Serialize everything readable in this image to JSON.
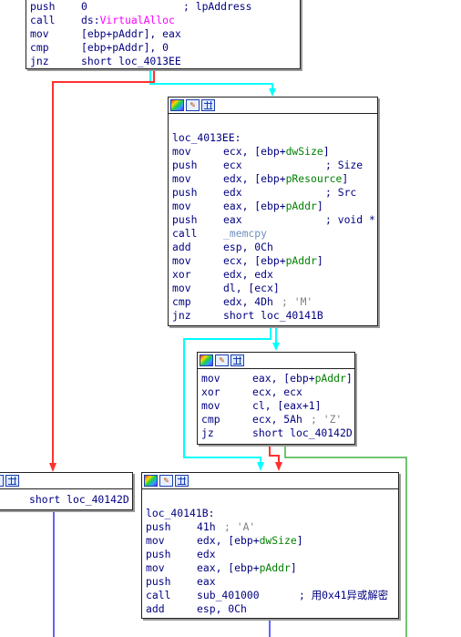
{
  "colors": {
    "edge_true": "#00ffff",
    "edge_false": "#ff3030",
    "edge_uncond": "#3030ff",
    "edge_green": "#40b040",
    "text": "#000080",
    "argument": "#008000",
    "import": "#ff00ff",
    "function": "#7090c0",
    "comment": "#808080"
  },
  "toolbar_icons": [
    "color-palette-icon",
    "edit-pencil-icon",
    "graph-view-icon"
  ],
  "block_top": {
    "lines": [
      {
        "mn": "push",
        "op": "0",
        "cm": "; lpAddress"
      },
      {
        "mn": "call",
        "op_pre": "ds:",
        "op_imp": "VirtualAlloc"
      },
      {
        "mn": "mov",
        "op": "[ebp+pAddr], eax"
      },
      {
        "mn": "cmp",
        "op": "[ebp+pAddr], 0"
      },
      {
        "mn": "jnz",
        "op": "short loc_4013EE"
      }
    ]
  },
  "block_4013ee": {
    "label": "loc_4013EE:",
    "lines": [
      {
        "mn": "mov",
        "op": "ecx, [ebp+",
        "arg": "dwSize",
        "post": "]"
      },
      {
        "mn": "push",
        "op": "ecx",
        "cm": "; Size"
      },
      {
        "mn": "mov",
        "op": "edx, [ebp+",
        "arg": "pResource",
        "post": "]"
      },
      {
        "mn": "push",
        "op": "edx",
        "cm": "; Src"
      },
      {
        "mn": "mov",
        "op": "eax, [ebp+",
        "arg": "pAddr",
        "post": "]"
      },
      {
        "mn": "push",
        "op": "eax",
        "cm": "; void *"
      },
      {
        "mn": "call",
        "fn": "_memcpy"
      },
      {
        "mn": "add",
        "op": "esp, 0Ch"
      },
      {
        "mn": "mov",
        "op": "ecx, [ebp+",
        "arg": "pAddr",
        "post": "]"
      },
      {
        "mn": "xor",
        "op": "edx, edx"
      },
      {
        "mn": "mov",
        "op": "dl, [ecx]"
      },
      {
        "mn": "cmp",
        "op": "edx, 4Dh",
        "cm": "; 'M'"
      },
      {
        "mn": "jnz",
        "op": "short loc_40141B"
      }
    ]
  },
  "block_mz": {
    "lines": [
      {
        "mn": "mov",
        "op": "eax, [ebp+",
        "arg": "pAddr",
        "post": "]"
      },
      {
        "mn": "xor",
        "op": "ecx, ecx"
      },
      {
        "mn": "mov",
        "op": "cl, [eax+1]"
      },
      {
        "mn": "cmp",
        "op": "ecx, 5Ah",
        "cm": "; 'Z'"
      },
      {
        "mn": "jz",
        "op": "short loc_40142D"
      }
    ]
  },
  "block_left": {
    "text": "short loc_40142D"
  },
  "block_40141b": {
    "label": "loc_40141B:",
    "lines": [
      {
        "mn": "push",
        "op": "41h",
        "cm": "; 'A'"
      },
      {
        "mn": "mov",
        "op": "edx, [ebp+",
        "arg": "dwSize",
        "post": "]"
      },
      {
        "mn": "push",
        "op": "edx"
      },
      {
        "mn": "mov",
        "op": "eax, [ebp+",
        "arg": "pAddr",
        "post": "]"
      },
      {
        "mn": "push",
        "op": "eax"
      },
      {
        "mn": "call",
        "op": "sub_401000",
        "cm": "; 用0x41异或解密"
      },
      {
        "mn": "add",
        "op": "esp, 0Ch"
      }
    ]
  }
}
